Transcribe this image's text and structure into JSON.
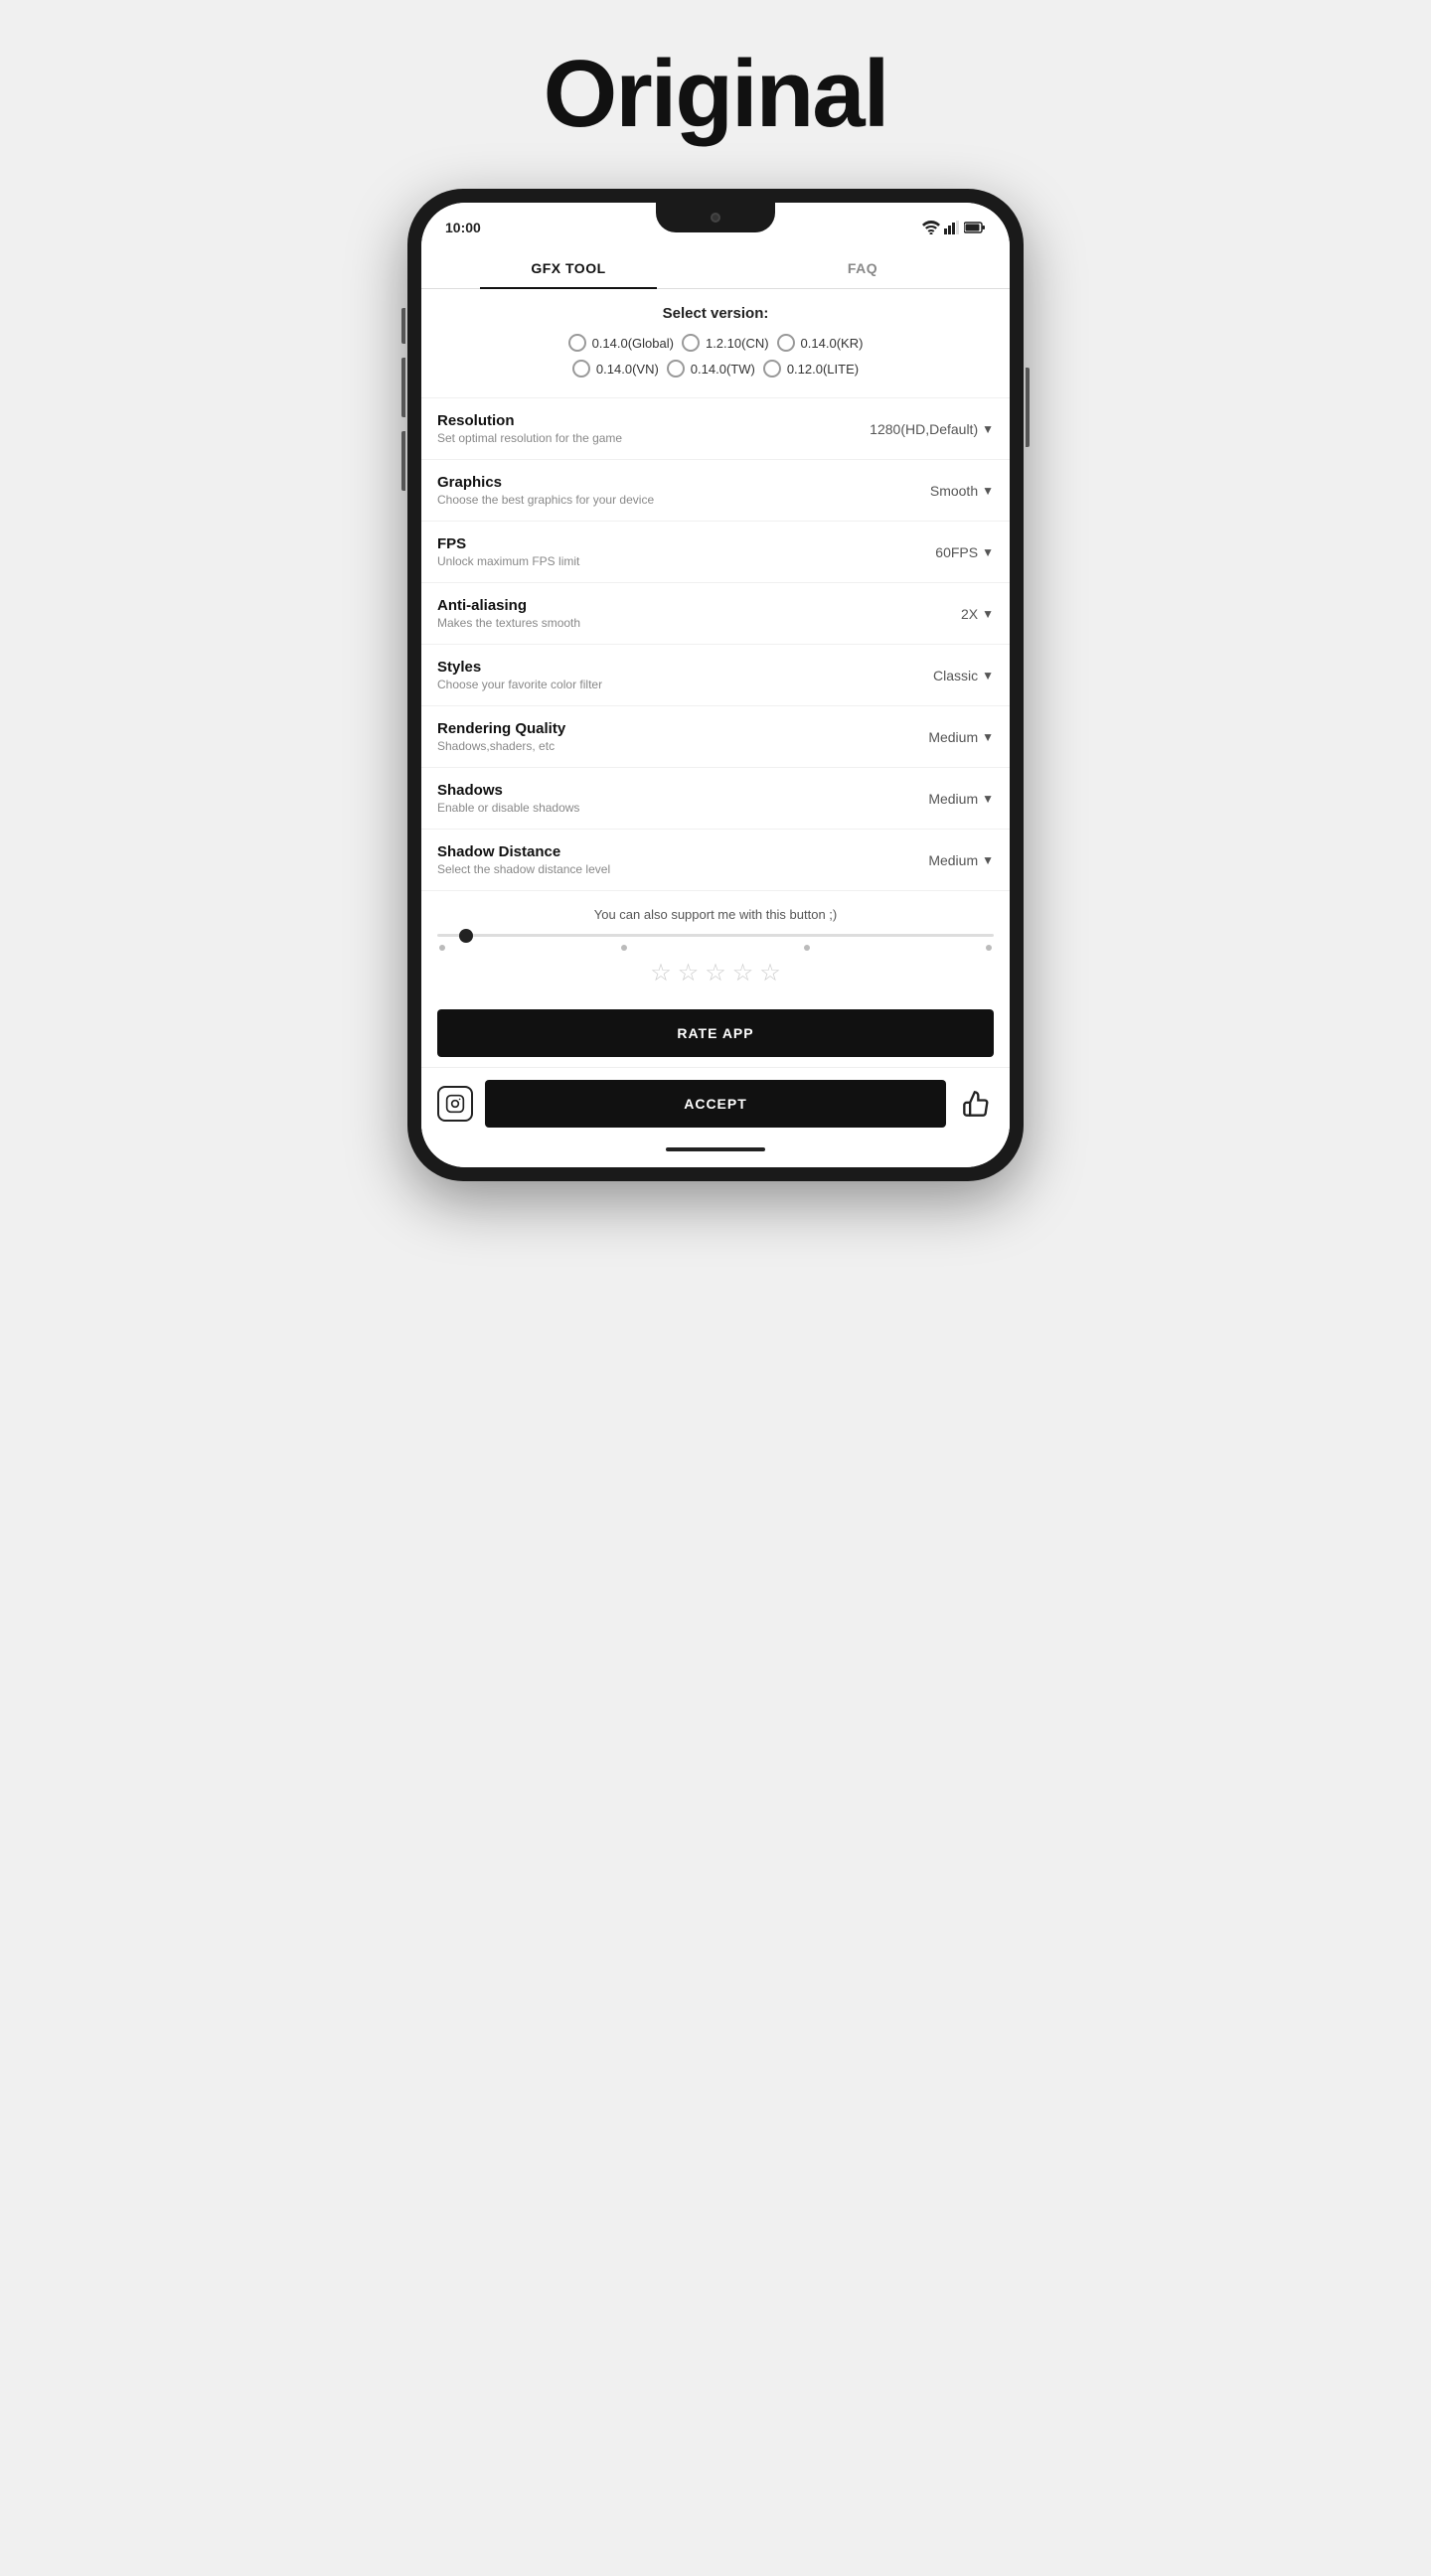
{
  "page": {
    "title": "Original"
  },
  "tabs": {
    "items": [
      {
        "id": "gfx-tool",
        "label": "GFX TOOL",
        "active": true
      },
      {
        "id": "faq",
        "label": "FAQ",
        "active": false
      }
    ]
  },
  "version": {
    "title": "Select version:",
    "options": [
      {
        "id": "global",
        "label": "0.14.0(Global)",
        "selected": false
      },
      {
        "id": "cn",
        "label": "1.2.10(CN)",
        "selected": false
      },
      {
        "id": "kr",
        "label": "0.14.0(KR)",
        "selected": false
      },
      {
        "id": "vn",
        "label": "0.14.0(VN)",
        "selected": false
      },
      {
        "id": "tw",
        "label": "0.14.0(TW)",
        "selected": false
      },
      {
        "id": "lite",
        "label": "0.12.0(LITE)",
        "selected": false
      }
    ]
  },
  "settings": [
    {
      "id": "resolution",
      "label": "Resolution",
      "desc": "Set optimal resolution for the game",
      "value": "1280(HD,Default)"
    },
    {
      "id": "graphics",
      "label": "Graphics",
      "desc": "Choose the best graphics for your device",
      "value": "Smooth"
    },
    {
      "id": "fps",
      "label": "FPS",
      "desc": "Unlock maximum FPS limit",
      "value": "60FPS"
    },
    {
      "id": "anti-aliasing",
      "label": "Anti-aliasing",
      "desc": "Makes the textures smooth",
      "value": "2X"
    },
    {
      "id": "styles",
      "label": "Styles",
      "desc": "Choose your favorite color filter",
      "value": "Classic"
    },
    {
      "id": "rendering-quality",
      "label": "Rendering Quality",
      "desc": "Shadows,shaders, etc",
      "value": "Medium"
    },
    {
      "id": "shadows",
      "label": "Shadows",
      "desc": "Enable or disable shadows",
      "value": "Medium"
    },
    {
      "id": "shadow-distance",
      "label": "Shadow Distance",
      "desc": "Select the shadow distance level",
      "value": "Medium"
    }
  ],
  "support": {
    "text": "You can also support me with this button ;)"
  },
  "rating": {
    "stars": [
      "☆",
      "☆",
      "☆",
      "☆",
      "☆"
    ]
  },
  "buttons": {
    "rate_app": "RATE APP",
    "accept": "ACCEPT"
  },
  "status_bar": {
    "time": "10:00"
  }
}
